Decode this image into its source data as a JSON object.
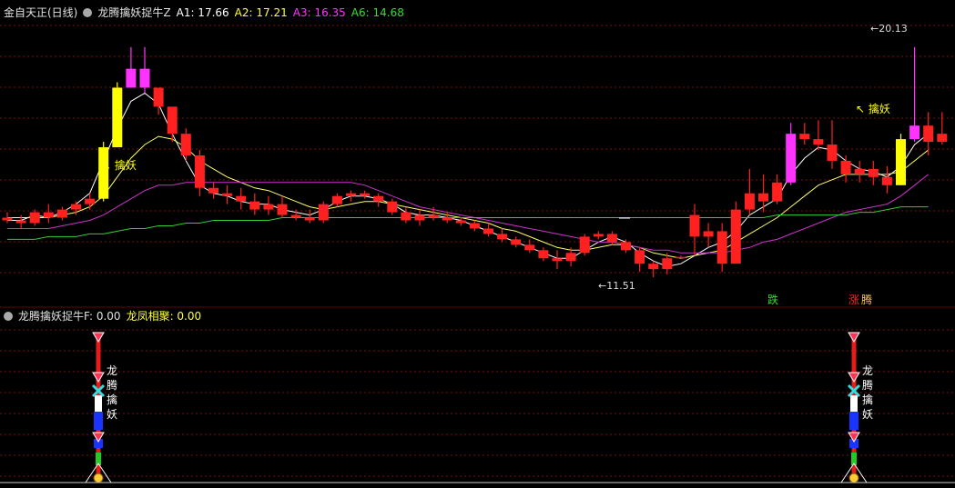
{
  "colors": {
    "bg": "#000000",
    "up": "#ff2020",
    "down": "#ff2020",
    "yellow": "#ffff00",
    "magenta": "#ff33ff",
    "a1": "#ffffff",
    "a2": "#ffff66",
    "a3": "#cc33cc",
    "a6": "#33cc33",
    "grid": "#7a1010"
  },
  "main_panel": {
    "title": "金自天正(日线)",
    "indicator": "龙腾擒妖捉牛Z",
    "a1_label": "A1: 17.66",
    "a2_label": "A2: 17.21",
    "a3_label": "A3: 16.35",
    "a6_label": "A6: 14.68",
    "label_qinyao": "擒妖",
    "label_high": "20.13",
    "label_low": "11.51",
    "label_die": "跌",
    "label_zhang": "涨",
    "label_teng": "腾"
  },
  "sub_panel": {
    "indicator": "龙腾擒妖捉牛F",
    "f_label": ": 0.00",
    "lf_label": "龙凤相聚: 0.00",
    "signal_text": [
      "龙",
      "腾",
      "擒",
      "妖"
    ]
  },
  "chart_data": {
    "type": "candlestick",
    "x": [
      1,
      2,
      3,
      4,
      5,
      6,
      7,
      8,
      9,
      10,
      11,
      12,
      13,
      14,
      15,
      16,
      17,
      18,
      19,
      20,
      21,
      22,
      23,
      24,
      25,
      26,
      27,
      28,
      29,
      30,
      31,
      32,
      33,
      34,
      35,
      36,
      37,
      38,
      39,
      40,
      41,
      42,
      43,
      44,
      45,
      46,
      47,
      48,
      49,
      50,
      51,
      52,
      53,
      54,
      55,
      56,
      57,
      58,
      59,
      60,
      61,
      62,
      63,
      64,
      65,
      66,
      67,
      68
    ],
    "ohlc": [
      [
        13.7,
        13.9,
        13.5,
        13.6
      ],
      [
        13.6,
        13.8,
        13.3,
        13.5
      ],
      [
        13.5,
        14.0,
        13.4,
        13.9
      ],
      [
        13.9,
        14.2,
        13.5,
        13.7
      ],
      [
        13.7,
        14.1,
        13.6,
        14.0
      ],
      [
        14.0,
        14.3,
        13.8,
        14.2
      ],
      [
        14.2,
        14.6,
        14.0,
        14.4
      ],
      [
        14.4,
        16.5,
        14.3,
        16.3
      ],
      [
        16.3,
        18.7,
        16.3,
        18.5
      ],
      [
        18.5,
        20.0,
        18.5,
        19.2
      ],
      [
        19.2,
        20.0,
        18.3,
        18.5
      ],
      [
        18.5,
        18.5,
        17.5,
        17.8
      ],
      [
        17.8,
        17.8,
        16.5,
        16.8
      ],
      [
        16.8,
        17.0,
        15.8,
        16.0
      ],
      [
        16.0,
        16.2,
        14.5,
        14.8
      ],
      [
        14.8,
        15.0,
        14.4,
        14.6
      ],
      [
        14.6,
        14.9,
        14.2,
        14.5
      ],
      [
        14.5,
        14.8,
        14.0,
        14.3
      ],
      [
        14.3,
        14.6,
        13.8,
        14.0
      ],
      [
        14.0,
        14.5,
        13.8,
        14.2
      ],
      [
        14.2,
        14.5,
        13.7,
        13.8
      ],
      [
        13.8,
        14.0,
        13.6,
        13.7
      ],
      [
        13.7,
        14.0,
        13.5,
        13.6
      ],
      [
        13.6,
        14.3,
        13.5,
        14.2
      ],
      [
        14.2,
        14.6,
        14.1,
        14.5
      ],
      [
        14.5,
        14.7,
        14.3,
        14.6
      ],
      [
        14.6,
        14.7,
        14.4,
        14.5
      ],
      [
        14.5,
        14.6,
        14.1,
        14.3
      ],
      [
        14.3,
        14.4,
        13.8,
        13.9
      ],
      [
        13.9,
        14.1,
        13.5,
        13.6
      ],
      [
        13.6,
        14.0,
        13.4,
        13.8
      ],
      [
        13.8,
        14.1,
        13.6,
        13.7
      ],
      [
        13.7,
        13.9,
        13.5,
        13.6
      ],
      [
        13.6,
        13.7,
        13.4,
        13.5
      ],
      [
        13.5,
        13.6,
        13.2,
        13.3
      ],
      [
        13.3,
        13.5,
        13.0,
        13.1
      ],
      [
        13.1,
        13.3,
        12.8,
        12.9
      ],
      [
        12.9,
        13.0,
        12.6,
        12.7
      ],
      [
        12.7,
        12.9,
        12.4,
        12.5
      ],
      [
        12.5,
        12.6,
        12.1,
        12.2
      ],
      [
        12.2,
        12.5,
        11.8,
        12.1
      ],
      [
        12.1,
        12.6,
        11.9,
        12.4
      ],
      [
        12.4,
        13.1,
        12.3,
        13.0
      ],
      [
        13.0,
        13.2,
        12.9,
        13.1
      ],
      [
        13.1,
        13.2,
        12.7,
        12.8
      ],
      [
        12.8,
        12.9,
        12.4,
        12.5
      ],
      [
        12.5,
        12.6,
        11.7,
        12.0
      ],
      [
        12.0,
        12.1,
        11.5,
        11.8
      ],
      [
        11.8,
        12.4,
        11.6,
        12.2
      ],
      [
        12.2,
        12.3,
        12.2,
        12.25
      ],
      [
        13.8,
        14.2,
        12.3,
        13.0
      ],
      [
        13.0,
        13.5,
        12.6,
        13.2
      ],
      [
        13.2,
        13.5,
        11.7,
        12.0
      ],
      [
        12.0,
        14.3,
        12.3,
        14.0
      ],
      [
        14.0,
        15.5,
        13.8,
        14.6
      ],
      [
        14.6,
        15.3,
        13.9,
        14.3
      ],
      [
        14.3,
        15.3,
        14.2,
        15.0
      ],
      [
        15.0,
        17.2,
        14.9,
        16.8
      ],
      [
        16.8,
        17.2,
        16.4,
        16.6
      ],
      [
        16.6,
        17.3,
        16.2,
        16.4
      ],
      [
        16.4,
        17.3,
        15.5,
        15.8
      ],
      [
        15.8,
        16.0,
        15.0,
        15.3
      ],
      [
        15.3,
        15.8,
        15.0,
        15.5
      ],
      [
        15.5,
        15.8,
        14.9,
        15.2
      ],
      [
        15.2,
        15.6,
        14.6,
        14.9
      ],
      [
        14.9,
        16.8,
        14.9,
        16.6
      ],
      [
        16.6,
        20.0,
        16.5,
        17.1
      ],
      [
        17.1,
        17.6,
        16.0,
        16.5
      ],
      [
        16.5,
        17.6,
        16.4,
        16.8
      ]
    ],
    "series": [
      {
        "name": "A1",
        "values": [
          13.6,
          13.6,
          13.8,
          13.7,
          13.9,
          14.2,
          14.6,
          15.8,
          17.0,
          18.0,
          18.3,
          17.9,
          16.8,
          15.8,
          14.9,
          14.6,
          14.5,
          14.3,
          14.2,
          14.2,
          14.0,
          13.9,
          13.8,
          14.0,
          14.3,
          14.5,
          14.5,
          14.4,
          14.2,
          13.9,
          13.8,
          13.8,
          13.7,
          13.6,
          13.4,
          13.2,
          13.0,
          12.8,
          12.6,
          12.4,
          12.2,
          12.2,
          12.5,
          12.8,
          13.0,
          12.8,
          12.4,
          12.1,
          11.9,
          12.0,
          12.3,
          12.6,
          12.8,
          13.2,
          13.8,
          14.1,
          14.4,
          15.3,
          15.9,
          16.3,
          16.2,
          15.8,
          15.5,
          15.4,
          15.2,
          15.6,
          16.4,
          16.8
        ]
      },
      {
        "name": "A2",
        "values": [
          13.7,
          13.7,
          13.7,
          13.7,
          13.8,
          13.9,
          14.1,
          14.5,
          15.2,
          15.9,
          16.4,
          16.7,
          16.6,
          16.3,
          15.8,
          15.5,
          15.2,
          15.0,
          14.8,
          14.7,
          14.5,
          14.3,
          14.1,
          14.0,
          14.1,
          14.2,
          14.3,
          14.3,
          14.2,
          14.1,
          14.0,
          13.9,
          13.8,
          13.7,
          13.6,
          13.5,
          13.3,
          13.2,
          13.0,
          12.8,
          12.6,
          12.5,
          12.5,
          12.6,
          12.7,
          12.7,
          12.6,
          12.4,
          12.3,
          12.2,
          12.3,
          12.4,
          12.5,
          12.8,
          13.1,
          13.4,
          13.7,
          14.1,
          14.5,
          14.9,
          15.1,
          15.3,
          15.3,
          15.3,
          15.3,
          15.4,
          15.8,
          16.2
        ]
      },
      {
        "name": "A3",
        "values": [
          13.3,
          13.3,
          13.3,
          13.3,
          13.4,
          13.5,
          13.6,
          13.8,
          14.1,
          14.4,
          14.7,
          14.9,
          14.9,
          15.0,
          15.0,
          15.0,
          15.0,
          15.0,
          15.0,
          15.0,
          15.0,
          15.0,
          15.0,
          15.0,
          15.0,
          15.0,
          14.9,
          14.7,
          14.5,
          14.3,
          14.1,
          14.0,
          13.9,
          13.8,
          13.7,
          13.6,
          13.5,
          13.4,
          13.3,
          13.2,
          13.1,
          13.0,
          12.9,
          12.8,
          12.8,
          12.7,
          12.6,
          12.5,
          12.5,
          12.4,
          12.4,
          12.4,
          12.4,
          12.5,
          12.6,
          12.8,
          12.9,
          13.1,
          13.3,
          13.5,
          13.7,
          13.9,
          14.0,
          14.1,
          14.2,
          14.5,
          14.9,
          15.3
        ]
      },
      {
        "name": "A6",
        "values": [
          12.9,
          12.9,
          12.9,
          13.0,
          13.0,
          13.0,
          13.1,
          13.1,
          13.2,
          13.3,
          13.3,
          13.4,
          13.4,
          13.5,
          13.5,
          13.6,
          13.6,
          13.6,
          13.6,
          13.6,
          13.7,
          13.7,
          13.7,
          13.7,
          13.7,
          13.7,
          13.7,
          13.7,
          13.7,
          13.7,
          13.7,
          13.7,
          13.7,
          13.7,
          13.7,
          13.7,
          13.7,
          13.7,
          13.7,
          13.7,
          13.7,
          13.7,
          13.7,
          13.7,
          13.7,
          13.7,
          13.7,
          13.7,
          13.7,
          13.7,
          13.7,
          13.7,
          13.7,
          13.7,
          13.7,
          13.7,
          13.8,
          13.8,
          13.8,
          13.8,
          13.8,
          13.8,
          13.9,
          13.9,
          14.0,
          14.1,
          14.1,
          14.1
        ]
      }
    ],
    "ylim": [
      11.0,
      21.0
    ],
    "grid": true
  }
}
